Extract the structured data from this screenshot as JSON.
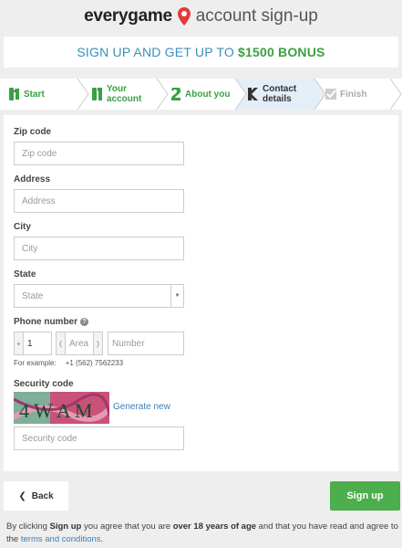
{
  "header": {
    "brand": "everygame",
    "subtitle": "account sign-up"
  },
  "promo": {
    "text": "SIGN UP AND GET UP TO ",
    "amount": "$1500 BONUS"
  },
  "steps": [
    {
      "label": "Start",
      "icon": "step-1-icon"
    },
    {
      "label": "Your account",
      "icon": "step-1-icon"
    },
    {
      "label": "About you",
      "icon": "step-2-icon"
    },
    {
      "label": "Contact details",
      "icon": "step-k-icon"
    },
    {
      "label": "Finish",
      "icon": "check-icon"
    }
  ],
  "form": {
    "zip": {
      "label": "Zip code",
      "placeholder": "Zip code"
    },
    "address": {
      "label": "Address",
      "placeholder": "Address"
    },
    "city": {
      "label": "City",
      "placeholder": "City"
    },
    "state": {
      "label": "State",
      "value": "State"
    },
    "phone": {
      "label": "Phone number",
      "country_prefix": "+",
      "country_value": "1",
      "area_prefix": "(",
      "area_placeholder": "Area",
      "area_suffix": ")",
      "number_placeholder": "Number",
      "example_label": "For example:",
      "example_value": "+1 (562) 7562233"
    },
    "security": {
      "label": "Security code",
      "captcha_text": "4 W A M",
      "generate_label": "Generate new",
      "placeholder": "Security code"
    }
  },
  "buttons": {
    "back": "Back",
    "signup": "Sign up"
  },
  "footnote": {
    "p1": "By clicking ",
    "b1": "Sign up",
    "p2": " you agree that you are ",
    "b2": "over 18 years of age",
    "p3": " and that you have read and agree to the ",
    "link": "terms and conditions",
    "p4": "."
  },
  "colors": {
    "green": "#3aa043",
    "blue": "#3b8fb8",
    "signup": "#4cae4c",
    "current_step": "#e3eef9"
  }
}
